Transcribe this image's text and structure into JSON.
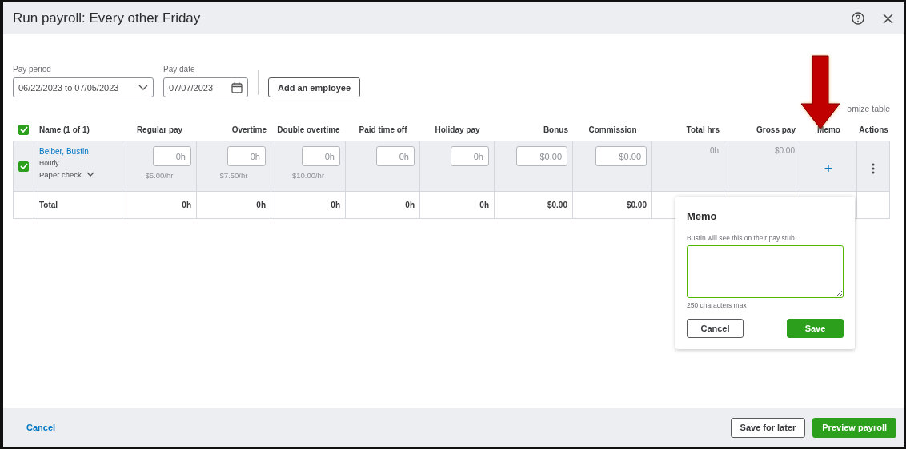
{
  "window": {
    "title": "Run payroll: Every other Friday"
  },
  "pay_period": {
    "label": "Pay period",
    "value": "06/22/2023 to 07/05/2023"
  },
  "pay_date": {
    "label": "Pay date",
    "value": "07/07/2023"
  },
  "add_employee": "Add an employee",
  "customize_table": "omize table",
  "table": {
    "all_checked": true,
    "columns": [
      "Name (1 of 1)",
      "Regular pay",
      "Overtime",
      "Double overtime",
      "Paid time off",
      "Holiday pay",
      "Bonus",
      "Commission",
      "Total hrs",
      "Gross pay",
      "Memo",
      "Actions"
    ],
    "rows": [
      {
        "selected": true,
        "cells": [
          {
            "kind": "employee",
            "name": "Beiber, Bustin",
            "pay_type": "Hourly",
            "payment_method": "Paper check"
          },
          {
            "kind": "input",
            "placeholder": "0h",
            "rate": "$5.00/hr"
          },
          {
            "kind": "input",
            "placeholder": "0h",
            "rate": "$7.50/hr"
          },
          {
            "kind": "input",
            "placeholder": "0h",
            "rate": "$10.00/hr"
          },
          {
            "kind": "input",
            "placeholder": "0h"
          },
          {
            "kind": "input",
            "placeholder": "0h"
          },
          {
            "kind": "money",
            "placeholder": "$0.00"
          },
          {
            "kind": "money",
            "placeholder": "$0.00"
          },
          {
            "kind": "text",
            "text": "0h"
          },
          {
            "kind": "text",
            "text": "$0.00"
          },
          {
            "kind": "add",
            "text": "+"
          },
          {
            "kind": "menu"
          }
        ]
      }
    ],
    "total": {
      "cells": [
        "Total",
        "0h",
        "0h",
        "0h",
        "0h",
        "0h",
        "$0.00",
        "$0.00"
      ]
    }
  },
  "memo_popover": {
    "title": "Memo",
    "hint": "Bustin will see this on their pay stub.",
    "limit": "250 characters max",
    "cancel": "Cancel",
    "save": "Save"
  },
  "footer": {
    "cancel": "Cancel",
    "save_for_later": "Save for later",
    "preview": "Preview payroll"
  }
}
